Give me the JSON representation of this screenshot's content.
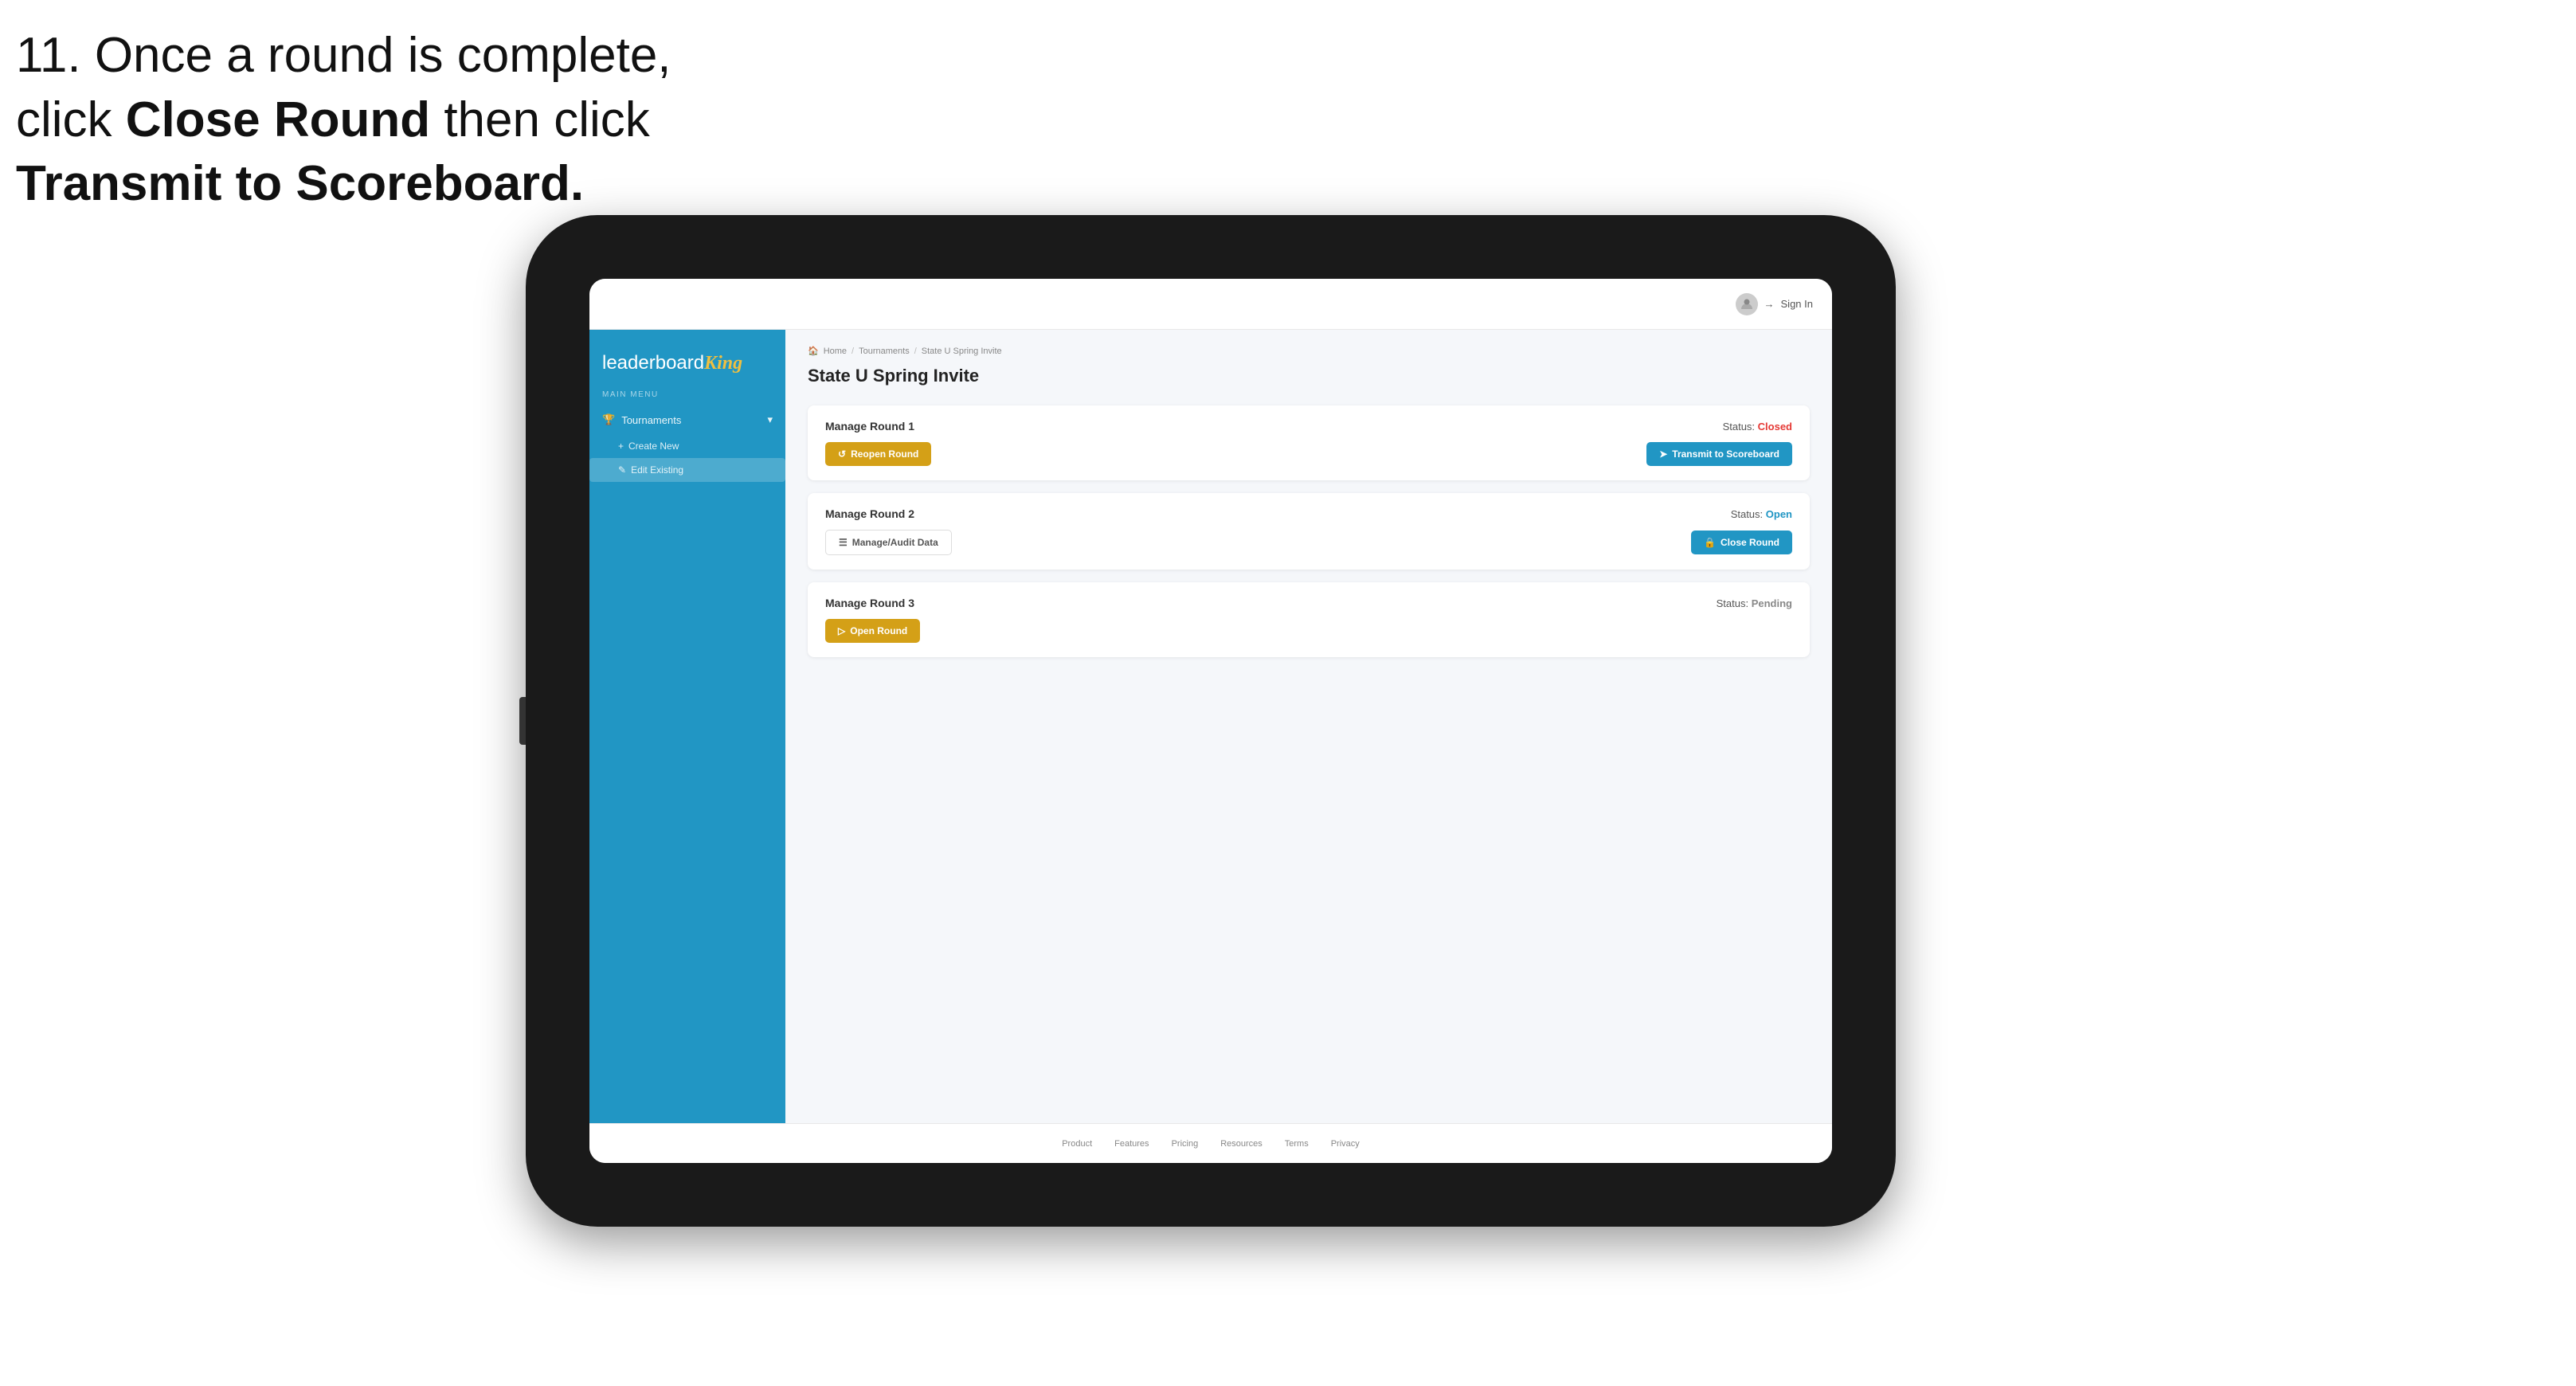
{
  "instruction": {
    "line1": "11. Once a round is complete,",
    "line2": "click ",
    "bold1": "Close Round",
    "line3": " then click",
    "line4": "Transmit to Scoreboard."
  },
  "topbar": {
    "signin_label": "Sign In"
  },
  "sidebar": {
    "logo_plain": "leaderboard",
    "logo_bold": "King",
    "menu_label": "MAIN MENU",
    "tournaments_label": "Tournaments",
    "create_new_label": "Create New",
    "edit_existing_label": "Edit Existing"
  },
  "breadcrumb": {
    "home": "Home",
    "tournaments": "Tournaments",
    "current": "State U Spring Invite"
  },
  "page": {
    "title": "State U Spring Invite"
  },
  "rounds": [
    {
      "id": "round1",
      "title": "Manage Round 1",
      "status_label": "Status:",
      "status_value": "Closed",
      "status_class": "status-closed",
      "primary_btn": "Reopen Round",
      "primary_btn_type": "amber",
      "secondary_btn": "Transmit to Scoreboard",
      "secondary_btn_type": "blue",
      "show_audit": false
    },
    {
      "id": "round2",
      "title": "Manage Round 2",
      "status_label": "Status:",
      "status_value": "Open",
      "status_class": "status-open",
      "primary_btn": "Manage/Audit Data",
      "primary_btn_type": "outline",
      "secondary_btn": "Close Round",
      "secondary_btn_type": "blue",
      "show_audit": true
    },
    {
      "id": "round3",
      "title": "Manage Round 3",
      "status_label": "Status:",
      "status_value": "Pending",
      "status_class": "status-pending",
      "primary_btn": "Open Round",
      "primary_btn_type": "amber",
      "secondary_btn": null
    }
  ],
  "footer": {
    "links": [
      "Product",
      "Features",
      "Pricing",
      "Resources",
      "Terms",
      "Privacy"
    ]
  }
}
